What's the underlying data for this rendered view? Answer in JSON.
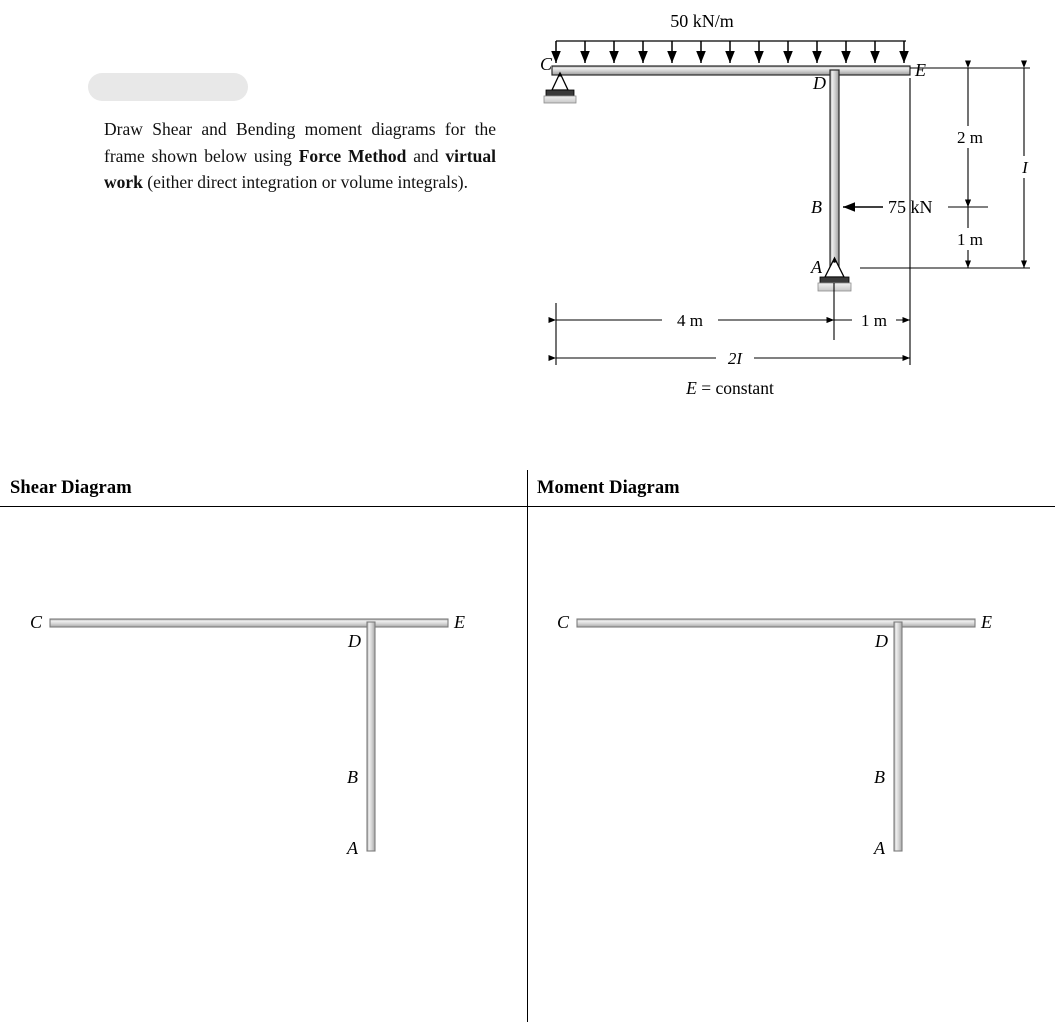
{
  "problem": {
    "redacted_placeholder": "",
    "text_runs": [
      {
        "t": "Draw Shear and Bending moment diagrams for the frame shown below using ",
        "b": false
      },
      {
        "t": "Force Method",
        "b": true
      },
      {
        "t": " and ",
        "b": false
      },
      {
        "t": "virtual work",
        "b": true
      },
      {
        "t": " (either direct integration or volume integrals).",
        "b": false
      }
    ],
    "full_text": "Draw Shear and Bending moment diagrams for the frame shown below using Force Method and virtual work (either direct integration or volume integrals)."
  },
  "figure": {
    "distributed_load_label": "50 kN/m",
    "point_load_label": "75 kN",
    "node_labels": {
      "C": "C",
      "D": "D",
      "E": "E",
      "B": "B",
      "A": "A"
    },
    "dimensions": {
      "horizontal_left": "4 m",
      "horizontal_right": "1 m",
      "vertical_upper": "2 m",
      "vertical_lower": "1 m"
    },
    "stiffness": {
      "beam": "2I",
      "column": "I",
      "modulus_note": "E = constant"
    },
    "supports": {
      "C": "pin-support",
      "A": "pin-support"
    },
    "load_arrow_count": 13,
    "colors": {
      "member_fill": "#c9c9c9",
      "member_edge": "#2b2b2b",
      "support_fill": "#d0d0d0",
      "line": "#000000"
    }
  },
  "answer_area": {
    "shear": {
      "title": "Shear Diagram",
      "frame_labels": {
        "C": "C",
        "D": "D",
        "E": "E",
        "B": "B",
        "A": "A"
      }
    },
    "moment": {
      "title": "Moment Diagram",
      "frame_labels": {
        "C": "C",
        "D": "D",
        "E": "E",
        "B": "B",
        "A": "A"
      }
    }
  }
}
